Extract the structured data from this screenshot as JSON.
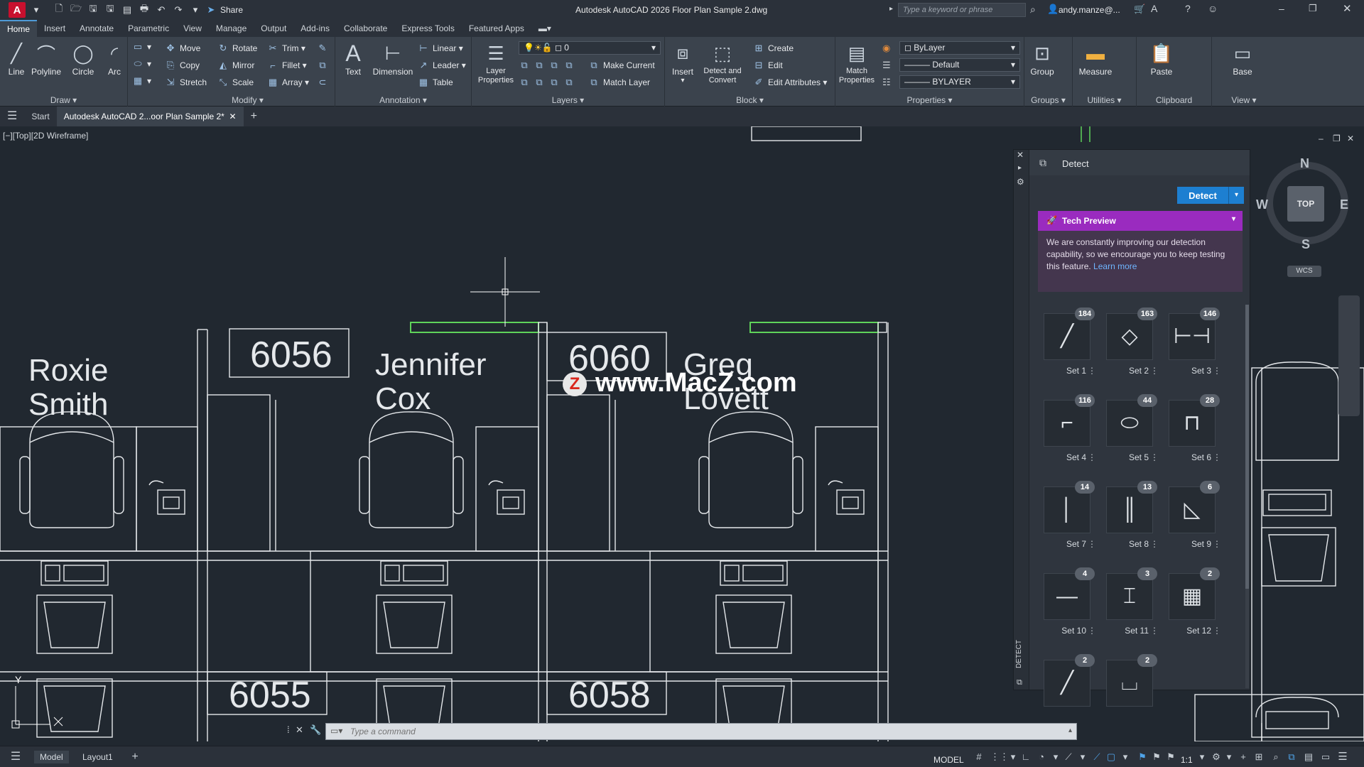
{
  "window": {
    "title": "Autodesk AutoCAD 2026   Floor Plan Sample 2.dwg",
    "share_label": "Share",
    "search_placeholder": "Type a keyword or phrase",
    "user": "andy.manze@..."
  },
  "menu_tabs": [
    "Home",
    "Insert",
    "Annotate",
    "Parametric",
    "View",
    "Manage",
    "Output",
    "Add-ins",
    "Collaborate",
    "Express Tools",
    "Featured Apps"
  ],
  "ribbon": {
    "draw": {
      "title": "Draw",
      "line": "Line",
      "polyline": "Polyline",
      "circle": "Circle",
      "arc": "Arc"
    },
    "modify": {
      "title": "Modify",
      "move": "Move",
      "rotate": "Rotate",
      "trim": "Trim",
      "copy": "Copy",
      "mirror": "Mirror",
      "fillet": "Fillet",
      "stretch": "Stretch",
      "scale": "Scale",
      "array": "Array"
    },
    "annotation": {
      "title": "Annotation",
      "text": "Text",
      "dimension": "Dimension",
      "linear": "Linear",
      "leader": "Leader",
      "table": "Table"
    },
    "layers": {
      "title": "Layers",
      "layer_properties": "Layer Properties",
      "layer_value": "0",
      "make_current": "Make Current",
      "match_layer": "Match Layer"
    },
    "insert": {
      "title": "Block",
      "insert": "Insert",
      "detect_convert": "Detect and Convert",
      "create": "Create",
      "edit": "Edit",
      "edit_attributes": "Edit Attributes"
    },
    "properties": {
      "title": "Properties",
      "match_properties": "Match Properties",
      "color": "ByLayer",
      "linetype": "Default",
      "lineweight": "BYLAYER"
    },
    "groups": {
      "title": "Groups",
      "group": "Group"
    },
    "utilities": {
      "title": "Utilities",
      "measure": "Measure"
    },
    "clipboard": {
      "title": "Clipboard",
      "paste": "Paste"
    },
    "view": {
      "title": "View",
      "base": "Base"
    }
  },
  "file_tabs": {
    "start": "Start",
    "active": "Autodesk AutoCAD 2...oor Plan Sample 2*"
  },
  "viewport": {
    "label": "[−][Top][2D Wireframe]"
  },
  "drawing": {
    "names": [
      {
        "first": "Roxie",
        "last": "Smith"
      },
      {
        "first": "Jennifer",
        "last": "Cox"
      },
      {
        "first": "Greg",
        "last": "Lovett"
      }
    ],
    "rooms": [
      "6056",
      "6060",
      "6055",
      "6058"
    ]
  },
  "navigation": {
    "north": "N",
    "south": "S",
    "east": "E",
    "west": "W",
    "cube": "TOP",
    "wcs": "WCS"
  },
  "detect_panel": {
    "title": "Detect",
    "detect_button": "Detect",
    "tech_preview": "Tech Preview",
    "message": "We are constantly improving our detection capability, so we encourage you to keep testing this feature.",
    "learn_more": "Learn more",
    "side_label": "DETECT",
    "sets": [
      {
        "label": "Set 1",
        "count": "184"
      },
      {
        "label": "Set 2",
        "count": "163"
      },
      {
        "label": "Set 3",
        "count": "146"
      },
      {
        "label": "Set 4",
        "count": "116"
      },
      {
        "label": "Set 5",
        "count": "44"
      },
      {
        "label": "Set 6",
        "count": "28"
      },
      {
        "label": "Set 7",
        "count": "14"
      },
      {
        "label": "Set 8",
        "count": "13"
      },
      {
        "label": "Set 9",
        "count": "6"
      },
      {
        "label": "Set 10",
        "count": "4"
      },
      {
        "label": "Set 11",
        "count": "3"
      },
      {
        "label": "Set 12",
        "count": "2"
      },
      {
        "label": "",
        "count": "2"
      },
      {
        "label": "",
        "count": "2"
      }
    ]
  },
  "command_line": {
    "placeholder": "Type a command"
  },
  "status_bar": {
    "model_tab": "Model",
    "layout_tab": "Layout1",
    "model": "MODEL",
    "scale": "1:1"
  },
  "watermark": {
    "text": "www.MacZ.com",
    "logo": "Z"
  },
  "colors": {
    "accent": "#1d7fd1",
    "tech_preview": "#9a2bbf",
    "canvas": "#212830",
    "ribbon": "#3b434d",
    "selection": "#5fd35a"
  }
}
